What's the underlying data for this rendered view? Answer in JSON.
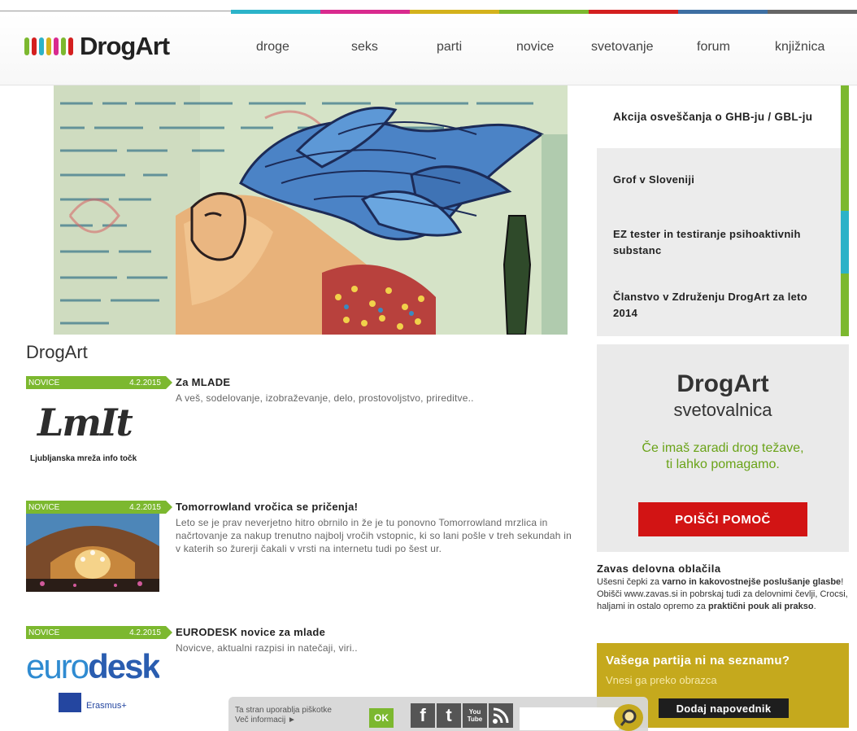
{
  "brand": {
    "name": "DrogArt"
  },
  "colors": {
    "strip": [
      "#2bb3c9",
      "#d92a8e",
      "#d4b21c",
      "#7cb82f",
      "#d41f1f",
      "#3e6fa3",
      "#666666"
    ],
    "logo_bars": [
      "#7cb82f",
      "#d41f1f",
      "#2bb3c9",
      "#d4b21c",
      "#d92a8e",
      "#7cb82f",
      "#d41f1f"
    ],
    "accent_green": "#7cb82f",
    "help_button": "#d21414",
    "suggest_bg": "#c5a91d"
  },
  "nav": [
    "droge",
    "seks",
    "parti",
    "novice",
    "svetovanje",
    "forum",
    "knjižnica"
  ],
  "side_list": [
    "Akcija osveščanja o GHB-ju / GBL-ju",
    "Grof v Sloveniji",
    "EZ tester in testiranje psihoaktivnih substanc",
    "Članstvo v Združenju DrogArt za leto 2014"
  ],
  "page_title": "DrogArt",
  "news": [
    {
      "category": "NOVICE",
      "date": "4.2.2015",
      "title": "Za MLADE",
      "text": "A veš, sodelovanje, izobraževanje, delo, prostovoljstvo, prireditve..",
      "thumb_label": "Ljubljanska mreža info točk",
      "thumb_logo": "LmIt"
    },
    {
      "category": "NOVICE",
      "date": "4.2.2015",
      "title": "Tomorrowland vročica se pričenja!",
      "text": "Leto se je prav neverjetno hitro obrnilo in že je tu ponovno Tomorrowland mrzlica in načrtovanje za nakup trenutno najbolj vročih vstopnic, ki so lani pošle v treh sekundah in v katerih so žurerji čakali v vrsti na internetu tudi po šest ur."
    },
    {
      "category": "NOVICE",
      "date": "4.2.2015",
      "title": "EURODESK novice za mlade",
      "text": "Novicve, aktualni razpisi in natečaji, viri..",
      "thumb_logo_a": "euro",
      "thumb_logo_b": "desk",
      "thumb_label": "Erasmus+"
    }
  ],
  "help": {
    "title": "DrogArt",
    "subtitle": "svetovalnica",
    "text_line1": "Če imaš zaradi drog težave,",
    "text_line2": "ti lahko pomagamo.",
    "button": "POIŠČI POMOČ"
  },
  "ad": {
    "title": "Zavas delovna oblačila",
    "text_1": "Ušesni čepki za ",
    "text_2": "varno in kakovostnejše poslušanje glasbe",
    "text_3": "! Obišči www.zavas.si in pobrskaj tudi za delovnimi čevlji, Crocsi, haljami in ostalo opremo za ",
    "text_4": "praktični pouk ali prakso",
    "text_5": "."
  },
  "suggest": {
    "title": "Vašega partija ni na seznamu?",
    "text": "Vnesi ga preko obrazca",
    "button": "Dodaj napovednik"
  },
  "cookie": {
    "line1": "Ta stran uporablja piškotke",
    "line2": "Več informacij ►",
    "ok": "OK"
  },
  "social": {
    "facebook": "f",
    "twitter": "t",
    "youtube_top": "You",
    "youtube_bottom": "Tube"
  },
  "search": {
    "placeholder": ""
  }
}
